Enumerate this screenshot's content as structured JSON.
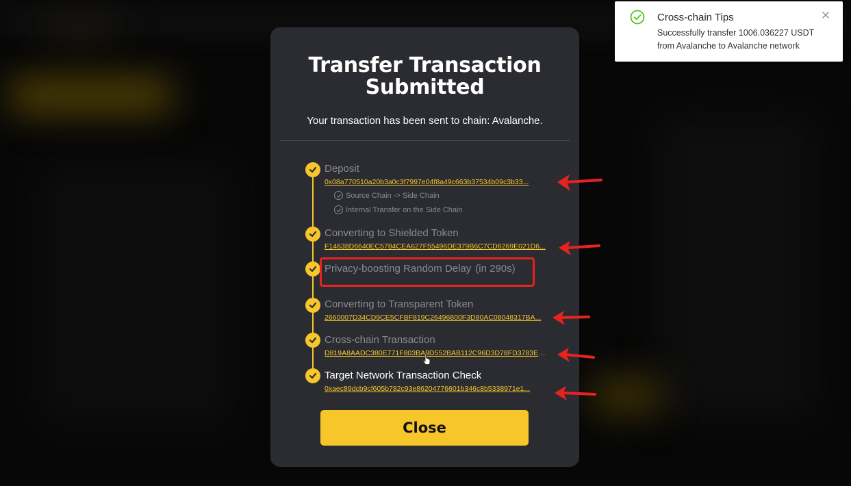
{
  "colors": {
    "accent": "#f6c62b",
    "modal_bg": "#2b2c31",
    "highlight": "#e8231f",
    "success": "#52c41a"
  },
  "modal": {
    "title_line1": "Transfer Transaction",
    "title_line2": "Submitted",
    "subtitle": "Your transaction has been sent to chain: Avalanche.",
    "close_label": "Close"
  },
  "steps": [
    {
      "title": "Deposit",
      "hash": "0x08a770510a20b3a0c3f7997e04f8a49c663b37534b09c3b33...",
      "sub_steps": [
        "Source Chain -> Side Chain",
        "Internal Transfer on the Side Chain"
      ]
    },
    {
      "title": "Converting to Shielded Token",
      "hash": "F14638D6640EC5784CEA627F55496DE379B6C7CD6269E021D6..."
    },
    {
      "title": "Privacy-boosting Random Delay",
      "delay": "(in 290s)"
    },
    {
      "title": "Converting to Transparent Token",
      "hash": "2660007D34CD9CE5CFBF819C26496800F3D80AC08048317BA..."
    },
    {
      "title": "Cross-chain Transaction",
      "hash": "D819A8AADC380E771F803BA9D552BAB112C96D3D78FD3783E18..."
    },
    {
      "title": "Target Network Transaction Check",
      "hash": "0xaec89dcb9cf605b782c93e86204776601b346c8b5338971e1..."
    }
  ],
  "toast": {
    "title": "Cross-chain Tips",
    "body": "Successfully transfer 1006.036227 USDT from Avalanche to Avalanche network",
    "icon": "check-circle-icon"
  }
}
